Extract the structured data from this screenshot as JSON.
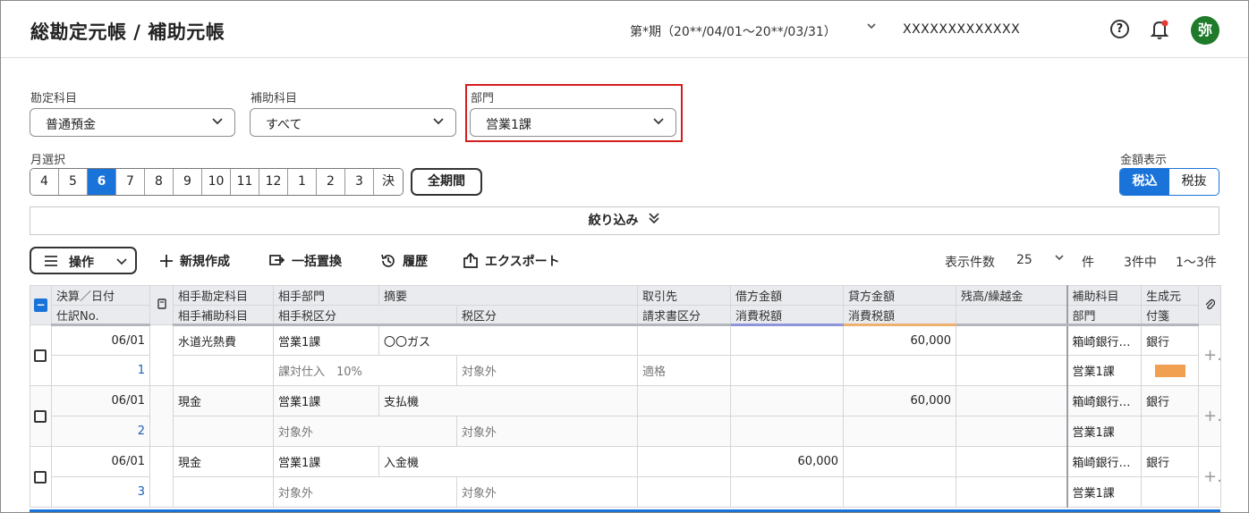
{
  "header": {
    "title": "総勘定元帳 / 補助元帳",
    "period": "第*期（20**/04/01〜20**/03/31）",
    "company": "XXXXXXXXXXXXX",
    "avatar": "弥"
  },
  "filters": {
    "account": {
      "label": "勘定科目",
      "value": "普通預金"
    },
    "sub_account": {
      "label": "補助科目",
      "value": "すべて"
    },
    "department": {
      "label": "部門",
      "value": "営業1課"
    }
  },
  "month_select": {
    "label": "月選択",
    "months": [
      "4",
      "5",
      "6",
      "7",
      "8",
      "9",
      "10",
      "11",
      "12",
      "1",
      "2",
      "3",
      "決"
    ],
    "selected": "6",
    "all_period": "全期間"
  },
  "amount_display": {
    "label": "金額表示",
    "options": [
      "税込",
      "税抜"
    ],
    "selected": "税込"
  },
  "narrow_down": "絞り込み",
  "toolbar": {
    "operations": "操作",
    "new": "新規作成",
    "bulk_replace": "一括置換",
    "history": "履歴",
    "export": "エクスポート",
    "per_page_label": "表示件数",
    "per_page": "25",
    "per_page_unit": "件",
    "count": "3件中",
    "range": "1〜3件"
  },
  "table": {
    "headers_top": [
      "決算／日付",
      "相手勘定科目",
      "相手部門",
      "摘要",
      "取引先",
      "借方金額",
      "貸方金額",
      "残高/繰越金",
      "補助科目",
      "生成元"
    ],
    "headers_bottom": [
      "仕訳No.",
      "相手補助科目",
      "相手税区分",
      "税区分",
      "請求書区分",
      "消費税額",
      "消費税額",
      "部門",
      "付箋"
    ],
    "rows": [
      {
        "date": "06/01",
        "no": "1",
        "counter_account": "水道光熱費",
        "counter_dept": "営業1課",
        "summary": "〇〇ガス",
        "partner": "",
        "debit": "",
        "credit": "60,000",
        "balance": "",
        "sub_account": "箱崎銀行…",
        "source": "銀行",
        "counter_tax": "課対仕入　10%",
        "tax": "対象外",
        "invoice": "適格",
        "dept": "営業1課",
        "tag": "orange"
      },
      {
        "date": "06/01",
        "no": "2",
        "counter_account": "現金",
        "counter_dept": "営業1課",
        "summary": "支払機",
        "partner": "",
        "debit": "",
        "credit": "60,000",
        "balance": "",
        "sub_account": "箱崎銀行…",
        "source": "銀行",
        "counter_tax": "対象外",
        "tax": "対象外",
        "invoice": "",
        "dept": "営業1課",
        "tag": ""
      },
      {
        "date": "06/01",
        "no": "3",
        "counter_account": "現金",
        "counter_dept": "営業1課",
        "summary": "入金機",
        "partner": "",
        "debit": "60,000",
        "credit": "",
        "balance": "",
        "sub_account": "箱崎銀行…",
        "source": "銀行",
        "counter_tax": "対象外",
        "tax": "対象外",
        "invoice": "",
        "dept": "営業1課",
        "tag": ""
      }
    ]
  }
}
